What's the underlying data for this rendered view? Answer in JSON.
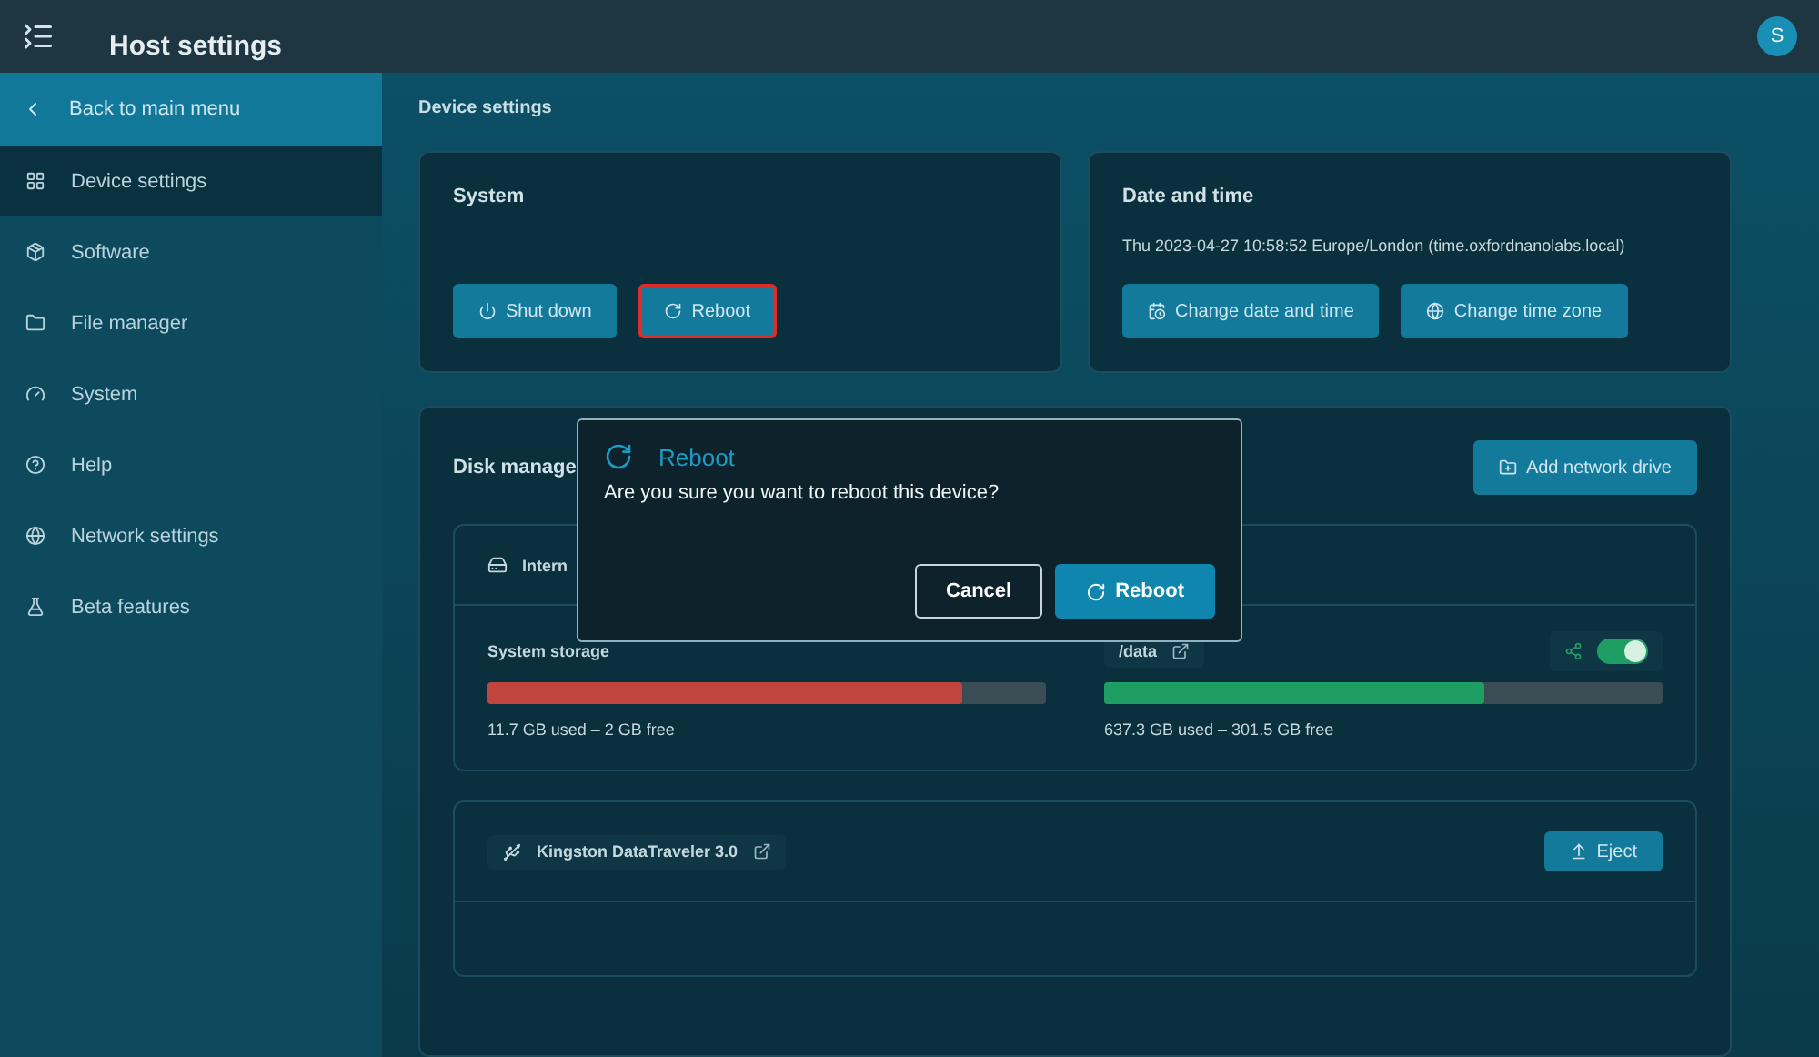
{
  "header": {
    "title": "Host settings",
    "avatar": "S"
  },
  "sidebar": {
    "back": "Back to main menu",
    "items": [
      {
        "label": "Device settings",
        "selected": true
      },
      {
        "label": "Software",
        "selected": false
      },
      {
        "label": "File manager",
        "selected": false
      },
      {
        "label": "System",
        "selected": false
      },
      {
        "label": "Help",
        "selected": false
      },
      {
        "label": "Network settings",
        "selected": false
      },
      {
        "label": "Beta features",
        "selected": false
      }
    ]
  },
  "page_title": "Device settings",
  "system_card": {
    "title": "System",
    "buttons": [
      {
        "label": "Shut down",
        "highlighted": false
      },
      {
        "label": "Reboot",
        "highlighted": true
      }
    ]
  },
  "date_card": {
    "title": "Date and time",
    "value": "Thu 2023-04-27 10:58:52 Europe/London (time.oxfordnanolabs.local)",
    "buttons": [
      {
        "label": "Change date and time"
      },
      {
        "label": "Change time zone"
      }
    ]
  },
  "disk_card": {
    "title": "Disk manage",
    "add_button": "Add network drive",
    "internal": {
      "label": "Intern"
    },
    "storages": [
      {
        "label": "System storage",
        "level": 0.85,
        "color": "#c0453f",
        "usage": "11.7 GB used – 2 GB free"
      },
      {
        "label": "/data",
        "level": 0.68,
        "color": "#1f9e63",
        "usage": "637.3 GB used – 301.5 GB free",
        "share_on": true
      }
    ],
    "usb": {
      "label": "Kingston DataTraveler 3.0",
      "eject": "Eject"
    }
  },
  "dialog": {
    "title": "Reboot",
    "message": "Are you sure you want to reboot this device?",
    "cancel": "Cancel",
    "confirm": "Reboot"
  }
}
